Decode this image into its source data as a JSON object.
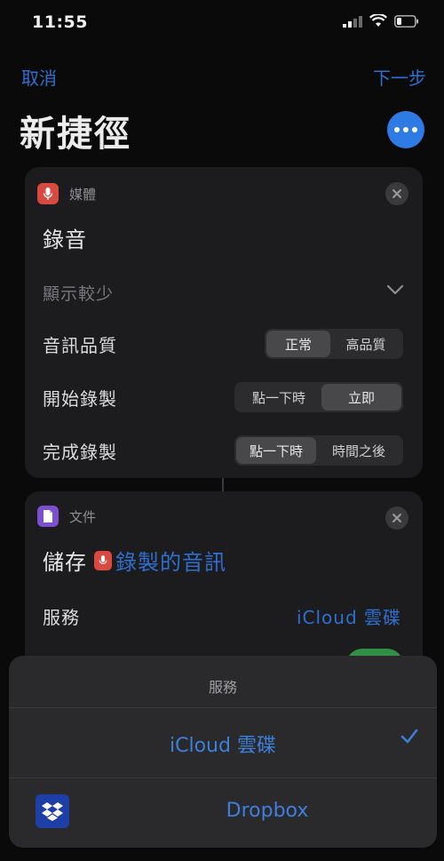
{
  "status_bar": {
    "time": "11:55"
  },
  "nav": {
    "cancel": "取消",
    "next": "下一步"
  },
  "page": {
    "title": "新捷徑"
  },
  "card1": {
    "category": "媒體",
    "action_title": "錄音",
    "show_less": "顯示較少",
    "rows": [
      {
        "label": "音訊品質",
        "options": [
          "正常",
          "高品質"
        ],
        "selected": "正常"
      },
      {
        "label": "開始錄製",
        "options": [
          "點一下時",
          "立即"
        ],
        "selected": "立即"
      },
      {
        "label": "完成錄製",
        "options": [
          "點一下時",
          "時間之後"
        ],
        "selected": "點一下時"
      }
    ]
  },
  "card2": {
    "category": "文件",
    "action_prefix": "儲存",
    "variable": "錄製的音訊",
    "service_label": "服務",
    "service_value": "iCloud 雲碟"
  },
  "sheet": {
    "title": "服務",
    "options": [
      "iCloud 雲碟",
      "Dropbox"
    ],
    "selected": "iCloud 雲碟"
  },
  "colors": {
    "accent": "#2f6fd0",
    "media": "#d84a3f",
    "document": "#7b4fd0",
    "dropbox": "#1f3fa8"
  },
  "icons": [
    "signal-icon",
    "wifi-icon",
    "battery-icon",
    "more-icon",
    "microphone-icon",
    "document-icon",
    "close-icon",
    "chevron-down-icon",
    "checkmark-icon",
    "dropbox-icon"
  ]
}
